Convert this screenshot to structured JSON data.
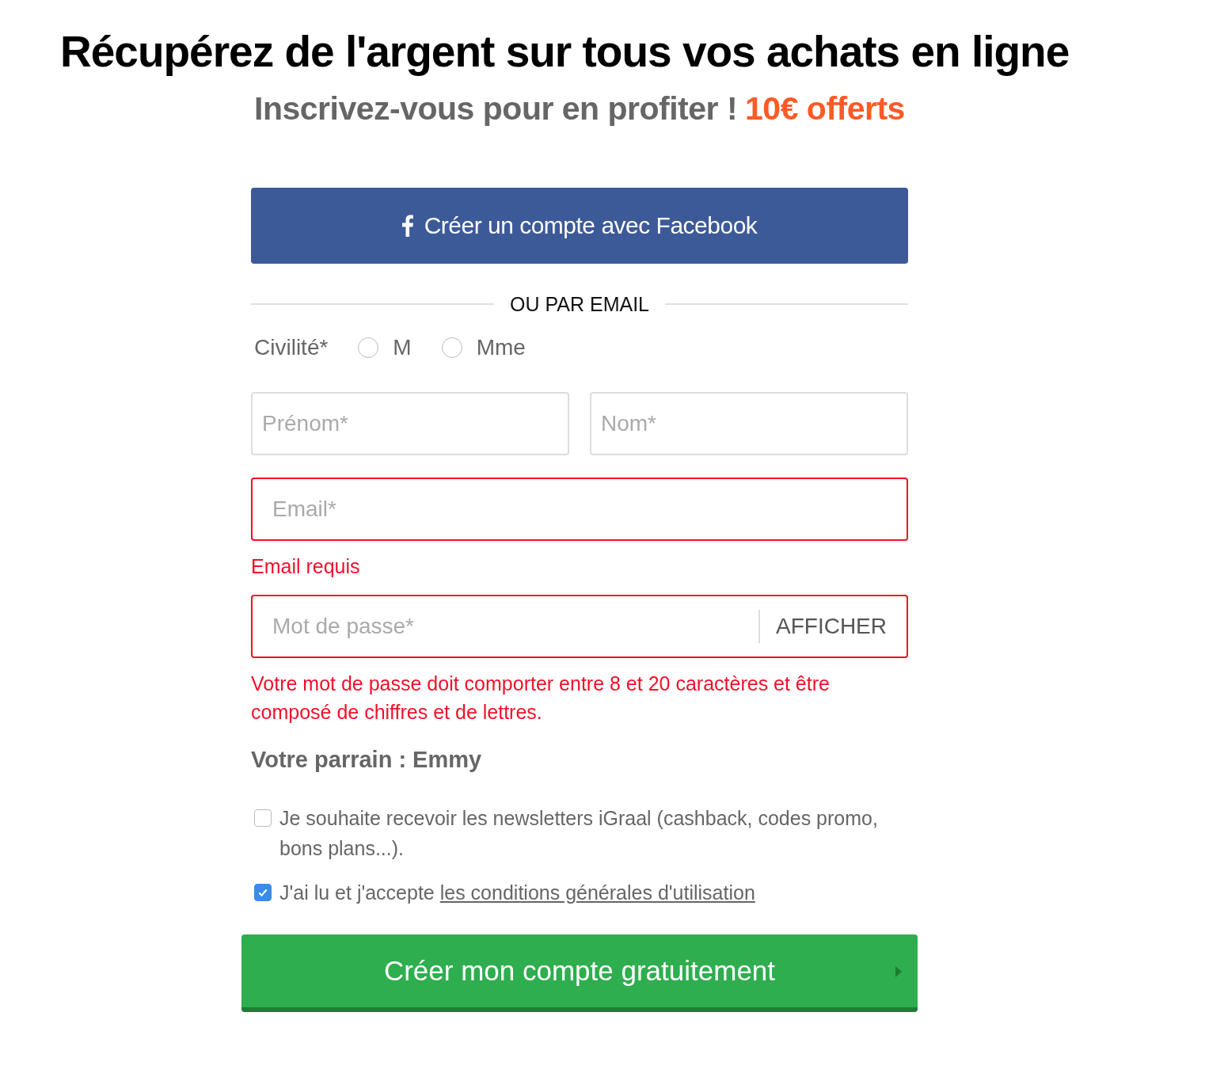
{
  "headline": "Récupérez de l'argent sur tous vos achats en ligne",
  "subheadline": {
    "text": "Inscrivez-vous pour en profiter !",
    "highlight": "10€ offerts"
  },
  "facebook_button": {
    "label": "Créer un compte avec Facebook"
  },
  "divider": "OU PAR EMAIL",
  "civility": {
    "label": "Civilité*",
    "options": [
      {
        "label": "M",
        "selected": false
      },
      {
        "label": "Mme",
        "selected": false
      }
    ]
  },
  "name_fields": [
    {
      "placeholder": "Prénom*",
      "invalid": false
    },
    {
      "placeholder": "Nom*",
      "invalid": false
    }
  ],
  "email": {
    "placeholder": "Email*",
    "invalid": true,
    "error": "Email requis"
  },
  "password": {
    "placeholder": "Mot de passe*",
    "toggle": "AFFICHER",
    "invalid": true,
    "error": "Votre mot de passe doit comporter entre 8 et 20 caractères et être composé de chiffres et de lettres."
  },
  "sponsor": "Votre parrain : Emmy",
  "consents": [
    {
      "text": "Je souhaite recevoir les newsletters iGraal (cashback, codes promo, bons plans...).",
      "checked": false
    },
    {
      "text": "J'ai lu et j'accepte",
      "link": "les conditions générales d'utilisation",
      "checked": true
    }
  ],
  "submit_button": {
    "label": "Créer mon compte gratuitement"
  }
}
